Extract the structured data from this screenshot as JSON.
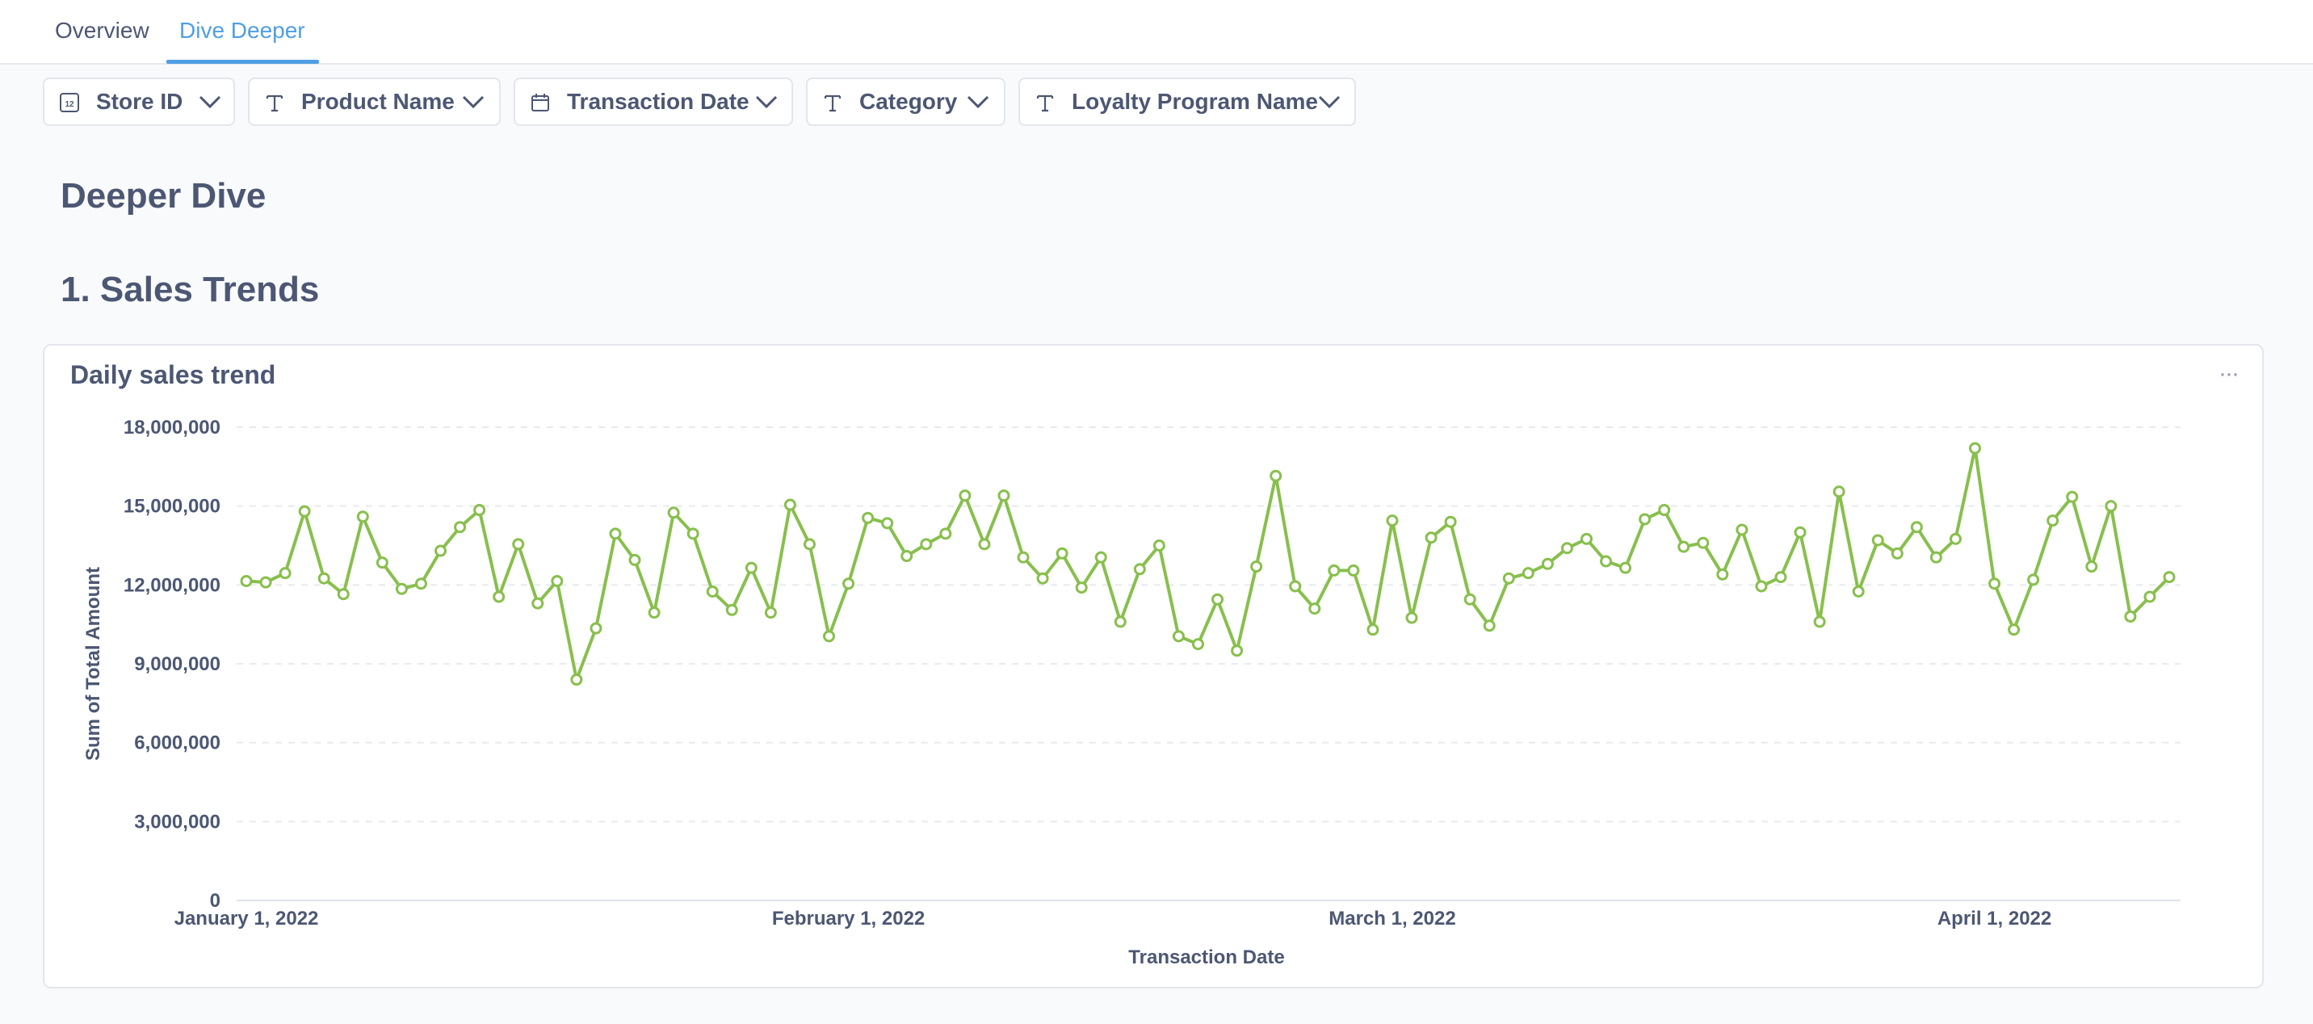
{
  "tabs": [
    {
      "label": "Overview",
      "active": false
    },
    {
      "label": "Dive Deeper",
      "active": true
    }
  ],
  "filters": [
    {
      "label": "Store ID",
      "icon": "number-icon"
    },
    {
      "label": "Product Name",
      "icon": "text-icon"
    },
    {
      "label": "Transaction Date",
      "icon": "calendar-icon"
    },
    {
      "label": "Category",
      "icon": "text-icon"
    },
    {
      "label": "Loyalty Program Name",
      "icon": "text-icon"
    }
  ],
  "headings": {
    "deeper_dive": "Deeper Dive",
    "sales_trends": "1. Sales Trends"
  },
  "card": {
    "title": "Daily sales trend",
    "menu": "···"
  },
  "colors": {
    "accent": "#509ee3",
    "line": "#88bf4d",
    "text": "#4c5773"
  },
  "chart_data": {
    "type": "line",
    "title": "Daily sales trend",
    "xlabel": "Transaction Date",
    "ylabel": "Sum of Total Amount",
    "ylim": [
      0,
      18000000
    ],
    "y_ticks": [
      0,
      3000000,
      6000000,
      9000000,
      12000000,
      15000000,
      18000000
    ],
    "y_tick_labels": [
      "0",
      "3,000,000",
      "6,000,000",
      "9,000,000",
      "12,000,000",
      "15,000,000",
      "18,000,000"
    ],
    "x_ticks": [
      {
        "date": "2022-01-01",
        "label": "January 1, 2022"
      },
      {
        "date": "2022-02-01",
        "label": "February 1, 2022"
      },
      {
        "date": "2022-03-01",
        "label": "March 1, 2022"
      },
      {
        "date": "2022-04-01",
        "label": "April 1, 2022"
      }
    ],
    "x_start": "2022-01-01",
    "grid": true,
    "series": [
      {
        "values": [
          12150000,
          12100000,
          12450000,
          14800000,
          12250000,
          11650000,
          14600000,
          12850000,
          11850000,
          12050000,
          13300000,
          14200000,
          14850000,
          11550000,
          13550000,
          11300000,
          12150000,
          8400000,
          10350000,
          13950000,
          12950000,
          10950000,
          14750000,
          13950000,
          11750000,
          11050000,
          12650000,
          10950000,
          15050000,
          13550000,
          10050000,
          12050000,
          14550000,
          14350000,
          13100000,
          13550000,
          13950000,
          15400000,
          13550000,
          15400000,
          13050000,
          12250000,
          13200000,
          11900000,
          13050000,
          10600000,
          12600000,
          13500000,
          10050000,
          9750000,
          11450000,
          9500000,
          12700000,
          16150000,
          11950000,
          11100000,
          12550000,
          12550000,
          10300000,
          14450000,
          10750000,
          13800000,
          14400000,
          11450000,
          10450000,
          12250000,
          12450000,
          12800000,
          13400000,
          13750000,
          12900000,
          12650000,
          14500000,
          14850000,
          13450000,
          13600000,
          12400000,
          14100000,
          11950000,
          12300000,
          14000000,
          10600000,
          15550000,
          11750000,
          13700000,
          13200000,
          14200000,
          13050000,
          13750000,
          17200000,
          12050000,
          10300000,
          12200000,
          14450000,
          15350000,
          12700000,
          15000000,
          10800000,
          11550000,
          12300000
        ]
      }
    ]
  }
}
